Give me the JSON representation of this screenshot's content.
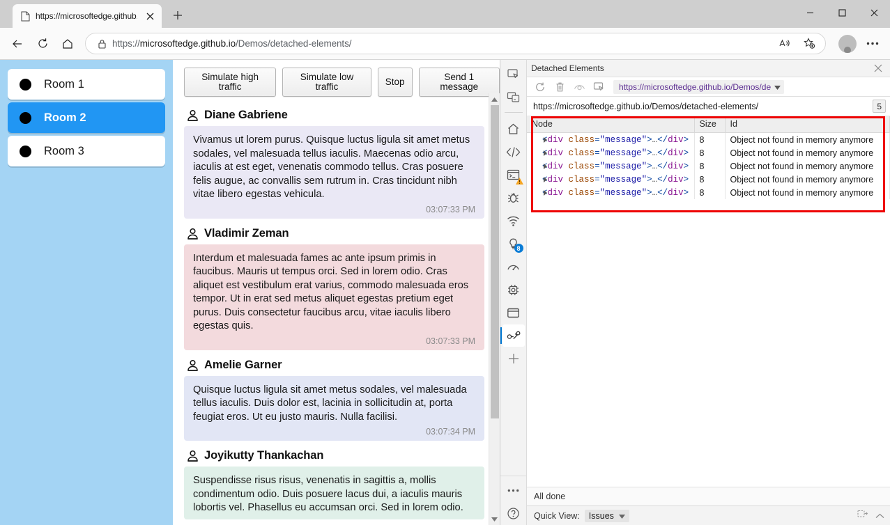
{
  "browser": {
    "tab": {
      "title": "https://microsoftedge.github.io/D",
      "favicon": "page-icon",
      "close": "×"
    },
    "new_tab_label": "+",
    "window_controls": {
      "minimize": "—",
      "maximize": "□",
      "close": "✕"
    },
    "nav": {
      "back": "←",
      "reload": "↻",
      "home": "home-icon"
    },
    "omnibox": {
      "url_scheme": "https://",
      "url_host": "microsoftedge.github.io",
      "url_path": "/Demos/detached-elements/",
      "lock_icon": "lock-icon",
      "read_aloud": "read-aloud-icon",
      "favorite": "add-favorite-icon",
      "profile": "profile-avatar",
      "settings": "…"
    }
  },
  "page": {
    "rooms": [
      {
        "label": "Room 1",
        "selected": false
      },
      {
        "label": "Room 2",
        "selected": true
      },
      {
        "label": "Room 3",
        "selected": false
      }
    ],
    "toolbar_buttons": [
      "Simulate high traffic",
      "Simulate low traffic",
      "Stop",
      "Send 1 message"
    ],
    "messages": [
      {
        "author": "Diane Gabriene",
        "text": "Vivamus ut lorem purus. Quisque luctus ligula sit amet metus sodales, vel malesuada tellus iaculis. Maecenas odio arcu, iaculis at est eget, venenatis commodo tellus. Cras posuere felis augue, ac convallis sem rutrum in. Cras tincidunt nibh vitae libero egestas vehicula.",
        "time": "03:07:33 PM",
        "color": "#eae8f5"
      },
      {
        "author": "Vladimir Zeman",
        "text": "Interdum et malesuada fames ac ante ipsum primis in faucibus. Mauris ut tempus orci. Sed in lorem odio. Cras aliquet est vestibulum erat varius, commodo malesuada eros tempor. Ut in erat sed metus aliquet egestas pretium eget purus. Duis consectetur faucibus arcu, vitae iaculis libero egestas quis.",
        "time": "03:07:33 PM",
        "color": "#f3dadd"
      },
      {
        "author": "Amelie Garner",
        "text": "Quisque luctus ligula sit amet metus sodales, vel malesuada tellus iaculis. Duis dolor est, lacinia in sollicitudin at, porta feugiat eros. Ut eu justo mauris. Nulla facilisi.",
        "time": "03:07:34 PM",
        "color": "#e2e6f5"
      },
      {
        "author": "Joyikutty Thankachan",
        "text": "Suspendisse risus risus, venenatis in sagittis a, mollis condimentum odio. Duis posuere lacus dui, a iaculis mauris lobortis vel. Phasellus eu accumsan orci. Sed in lorem odio.",
        "time": "",
        "color": "#e0f0e9"
      }
    ]
  },
  "devtools": {
    "activity_icons": [
      {
        "name": "inspect-element-icon",
        "active": false
      },
      {
        "name": "device-emulation-icon",
        "active": false
      },
      {
        "name": "welcome-home-icon",
        "active": false
      },
      {
        "name": "elements-code-icon",
        "active": false
      },
      {
        "name": "console-icon",
        "active": false,
        "badge": "warning"
      },
      {
        "name": "sources-debugger-icon",
        "active": false
      },
      {
        "name": "network-icon",
        "active": false
      },
      {
        "name": "issues-lightbulb-icon",
        "active": false,
        "badge": "8"
      },
      {
        "name": "performance-icon",
        "active": false
      },
      {
        "name": "memory-chip-icon",
        "active": false
      },
      {
        "name": "application-window-icon",
        "active": false
      },
      {
        "name": "detached-elements-icon",
        "active": true
      },
      {
        "name": "add-tool-plus-icon",
        "active": false
      },
      {
        "name": "more-tools-icon",
        "active": false
      },
      {
        "name": "help-question-icon",
        "active": false
      }
    ],
    "panel_title": "Detached Elements",
    "close_label": "✕",
    "toolbar": {
      "refresh": "refresh-icon",
      "clear": "trash-icon",
      "detach": "eye-icon",
      "analyze": "cursor-select-icon",
      "target_select": "https://microsoftedge.github.io/Demos/de"
    },
    "target_url": "https://microsoftedge.github.io/Demos/detached-elements/",
    "target_count": "5",
    "table": {
      "columns": [
        "Node",
        "Size",
        "Id"
      ],
      "rows": [
        {
          "node": "<div class=\"message\">…</div>",
          "size": "8",
          "id": "Object not found in memory anymore"
        },
        {
          "node": "<div class=\"message\">…</div>",
          "size": "8",
          "id": "Object not found in memory anymore"
        },
        {
          "node": "<div class=\"message\">…</div>",
          "size": "8",
          "id": "Object not found in memory anymore"
        },
        {
          "node": "<div class=\"message\">…</div>",
          "size": "8",
          "id": "Object not found in memory anymore"
        },
        {
          "node": "<div class=\"message\">…</div>",
          "size": "8",
          "id": "Object not found in memory anymore"
        }
      ]
    },
    "status": "All done",
    "quickview": {
      "label": "Quick View:",
      "selected": "Issues",
      "dock_icon": "dock-panel-icon",
      "collapse_icon": "chevron-up-icon"
    }
  },
  "colors": {
    "accent": "#0078d4",
    "room_selected": "#2196f3",
    "sidebar": "#a4d4f4",
    "highlight_box": "#ee0000"
  }
}
